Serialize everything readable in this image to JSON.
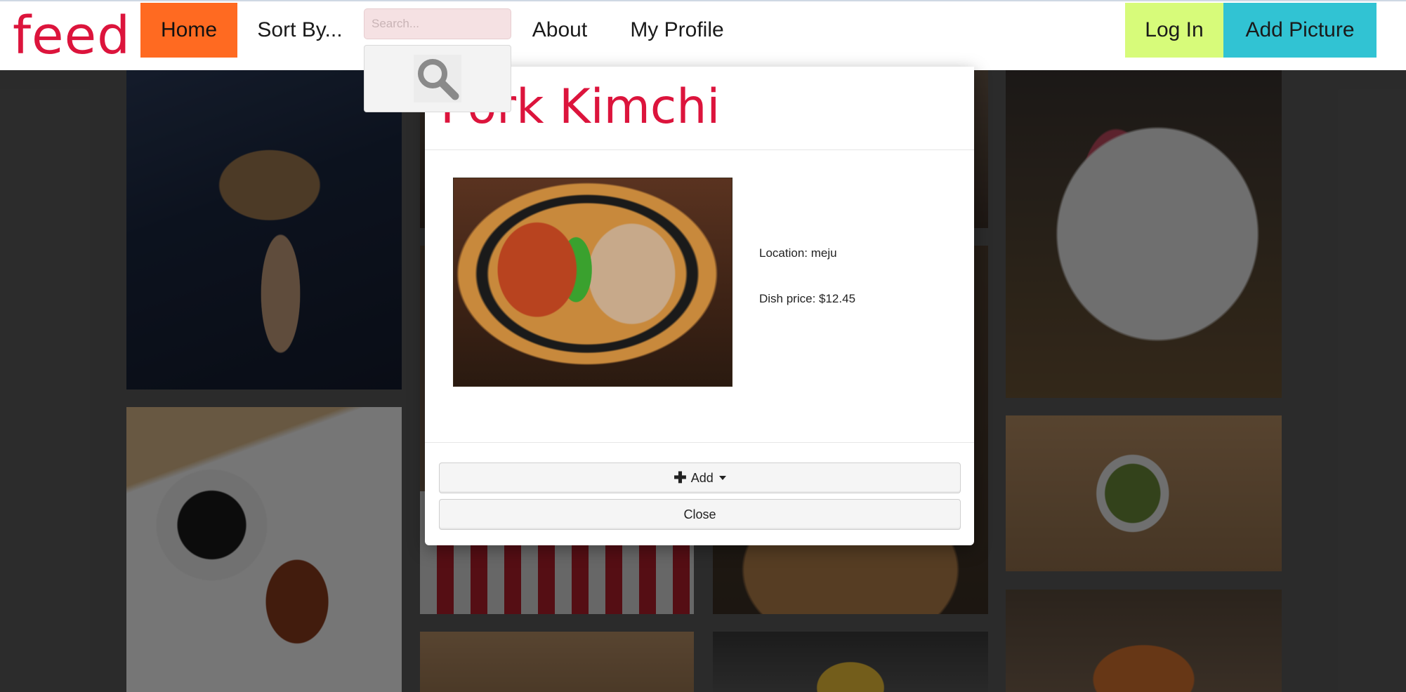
{
  "nav": {
    "logo": "feed",
    "home": "Home",
    "sort_by": "Sort By...",
    "search_placeholder": "Search...",
    "about": "About",
    "my_profile": "My Profile",
    "log_in": "Log In",
    "add_picture": "Add Picture"
  },
  "modal": {
    "title": "Pork Kimchi",
    "location": "Location: meju",
    "price": "Dish price: $12.45",
    "add_button": "Add",
    "close_button": "Close"
  },
  "colors": {
    "accent": "#dc143c",
    "home_bg": "#ff6a21",
    "login_bg": "#d7fb7a",
    "add_picture_bg": "#31c3d3"
  },
  "icons": {
    "search": "search-icon",
    "plus": "plus-icon",
    "caret": "caret-down-icon"
  }
}
